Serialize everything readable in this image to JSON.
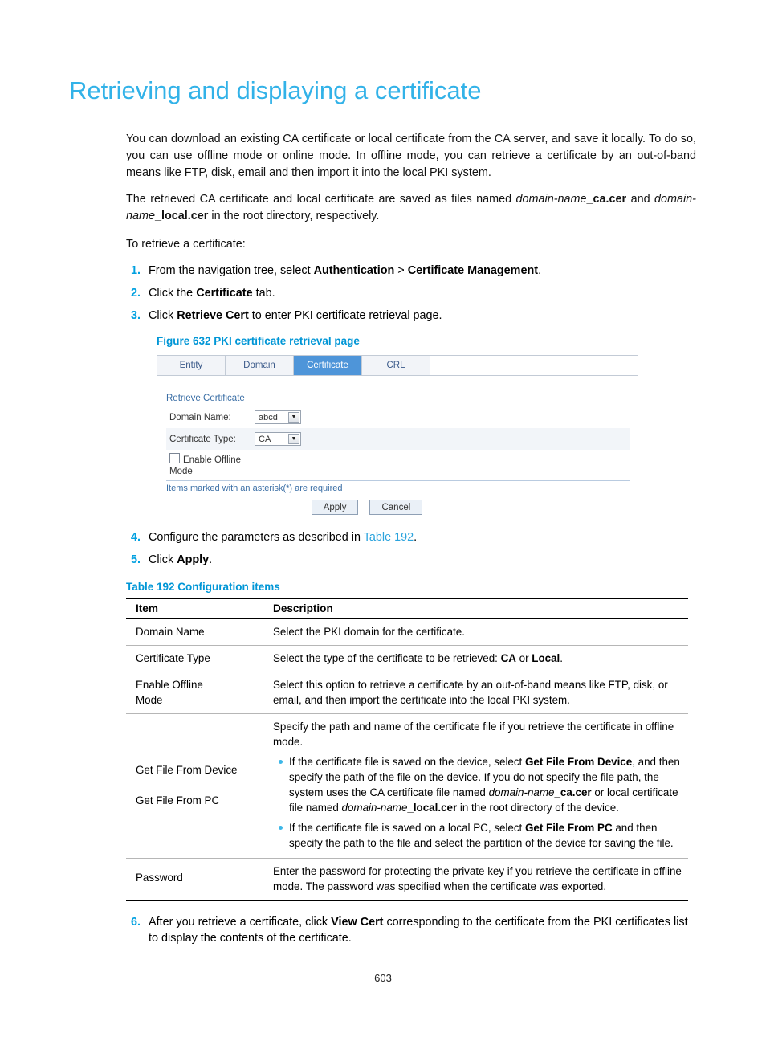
{
  "title": "Retrieving and displaying a certificate",
  "intro": {
    "p1": "You can download an existing CA certificate or local certificate from the CA server, and save it locally. To do so, you can use offline mode or online mode. In offline mode, you can retrieve a certificate by an out-of-band means like FTP, disk, email and then import it into the local PKI system.",
    "p2_a": "The retrieved CA certificate and local certificate are saved as files named ",
    "p2_i1": "domain-name",
    "p2_b1": "_ca.cer",
    "p2_b": " and ",
    "p2_i2": "domain-name",
    "p2_b2": "_local.cer",
    "p2_c": " in the root directory, respectively.",
    "p3": "To retrieve a certificate:"
  },
  "steps": [
    {
      "num": "1.",
      "pre": "From the navigation tree, select ",
      "bold1": "Authentication",
      "mid": " > ",
      "bold2": "Certificate Management",
      "post": "."
    },
    {
      "num": "2.",
      "pre": "Click the ",
      "bold1": "Certificate",
      "mid": "",
      "bold2": "",
      "post": " tab."
    },
    {
      "num": "3.",
      "pre": "Click ",
      "bold1": "Retrieve Cert",
      "mid": "",
      "bold2": "",
      "post": " to enter PKI certificate retrieval page."
    }
  ],
  "steps_after": [
    {
      "num": "4.",
      "pre": "Configure the parameters as described in ",
      "link": "Table 192",
      "post": "."
    },
    {
      "num": "5.",
      "pre": "Click ",
      "bold": "Apply",
      "post": "."
    }
  ],
  "step6": {
    "num": "6.",
    "pre": "After you retrieve a certificate, click ",
    "bold": "View Cert",
    "post": " corresponding to the certificate from the PKI certificates list to display the contents of the certificate."
  },
  "figure": {
    "caption": "Figure 632 PKI certificate retrieval page",
    "tabs": [
      {
        "label": "Entity",
        "active": false
      },
      {
        "label": "Domain",
        "active": false
      },
      {
        "label": "Certificate",
        "active": true
      },
      {
        "label": "CRL",
        "active": false
      }
    ],
    "form_title": "Retrieve Certificate",
    "fields": [
      {
        "label": "Domain Name:",
        "value": "abcd"
      },
      {
        "label": "Certificate Type:",
        "value": "CA"
      }
    ],
    "checkbox_label_line1": "Enable Offline",
    "checkbox_label_line2": "Mode",
    "note": "Items marked with an asterisk(*) are required",
    "buttons": [
      "Apply",
      "Cancel"
    ]
  },
  "table": {
    "caption": "Table 192 Configuration items",
    "headers": {
      "item": "Item",
      "description": "Description"
    },
    "rows": [
      {
        "item": "Domain Name",
        "desc": "Select the PKI domain for the certificate."
      },
      {
        "item": "Certificate Type",
        "desc_pre": "Select the type of the certificate to be retrieved: ",
        "desc_b1": "CA",
        "desc_mid": " or ",
        "desc_b2": "Local",
        "desc_post": "."
      },
      {
        "item_line1": "Enable Offline",
        "item_line2": "Mode",
        "desc": "Select this option to retrieve a certificate by an out-of-band means like FTP, disk, or email, and then import the certificate into the local PKI system."
      },
      {
        "item_line1": "Get File From Device",
        "item_line2": "Get File From PC",
        "desc_intro": "Specify the path and name of the certificate file if you retrieve the certificate in offline mode.",
        "bullet1": {
          "a": "If the certificate file is saved on the device, select ",
          "b1": "Get File From Device",
          "c": ", and then specify the path of the file on the device. If you do not specify the file path, the system uses the CA certificate file named ",
          "i1": "domain-name",
          "b2": "_ca.cer",
          "d": " or local certificate file named ",
          "i2": "domain-name",
          "b3": "_local.cer",
          "e": " in the root directory of the device."
        },
        "bullet2": {
          "a": "If the certificate file is saved on a local PC, select ",
          "b1": "Get File From PC",
          "c": " and then specify the path to the file and select the partition of the device for saving the file."
        }
      },
      {
        "item": "Password",
        "desc": "Enter the password for protecting the private key if you retrieve the certificate in offline mode. The password was specified when the certificate was exported."
      }
    ]
  },
  "page_number": "603"
}
